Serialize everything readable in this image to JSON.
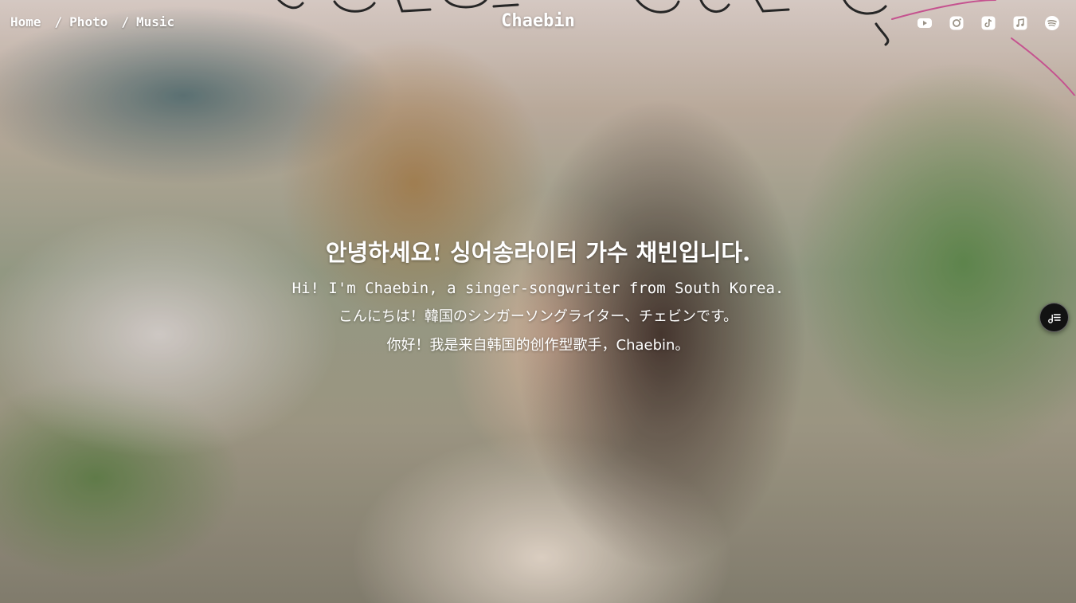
{
  "nav": {
    "breadcrumb": [
      {
        "label": "Home"
      },
      {
        "label": "Photo"
      },
      {
        "label": "Music"
      }
    ],
    "separator": "/",
    "brand": "Chaebin",
    "social_icons": [
      "youtube-icon",
      "instagram-icon",
      "tiktok-icon",
      "apple-music-icon",
      "spotify-icon"
    ]
  },
  "intro": {
    "korean": "안녕하세요! 싱어송라이터 가수 채빈입니다.",
    "english": "Hi! I'm Chaebin, a singer-songwriter from South Korea.",
    "japanese": "こんにちは！韓国のシンガーソングライター、チェビンです。",
    "chinese": "你好！我是来自韩国的创作型歌手，Chaebin。"
  },
  "playlist_button": {
    "icon": "playlist-icon"
  },
  "colors": {
    "text": "#ffffff",
    "playlist_bg": "#121212",
    "scribble_ink": "#2a2a2a",
    "scribble_pink": "#d65a9c"
  }
}
